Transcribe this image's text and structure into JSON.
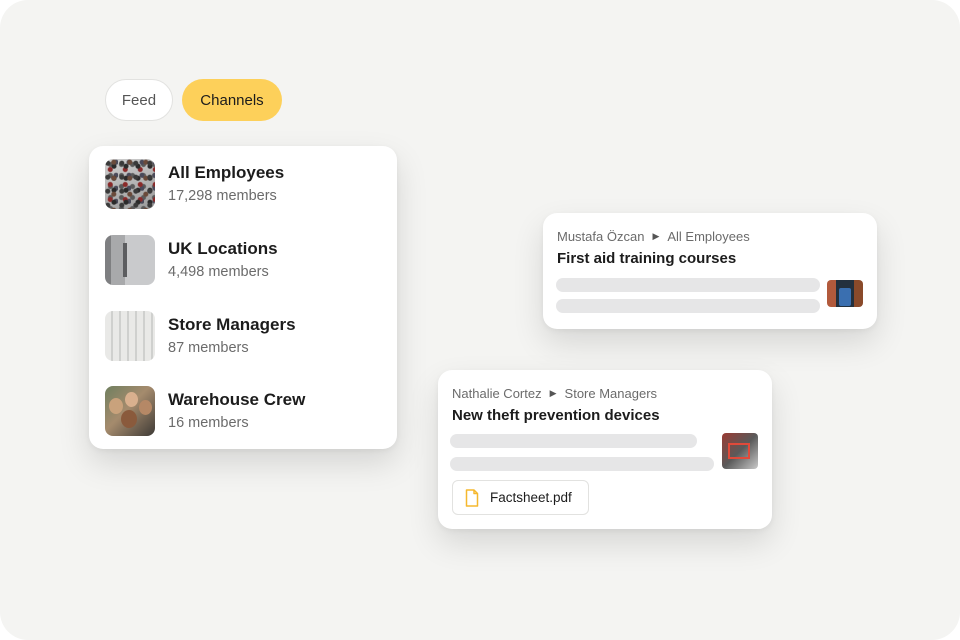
{
  "tabs": [
    {
      "label": "Feed"
    },
    {
      "label": "Channels"
    }
  ],
  "channels": [
    {
      "name": "All Employees",
      "members": "17,298 members",
      "icon": "crowd-photo"
    },
    {
      "name": "UK Locations",
      "members": "4,498 members",
      "icon": "building-photo"
    },
    {
      "name": "Store Managers",
      "members": "87 members",
      "icon": "facade-photo"
    },
    {
      "name": "Warehouse Crew",
      "members": "16 members",
      "icon": "team-photo"
    }
  ],
  "posts": [
    {
      "author": "Mustafa Özcan",
      "channel": "All Employees",
      "title": "First aid training courses"
    },
    {
      "author": "Nathalie Cortez",
      "channel": "Store Managers",
      "title": "New theft prevention devices",
      "attachment": "Factsheet.pdf"
    }
  ],
  "colors": {
    "accent": "#fdd05a",
    "background": "#f4f4f2",
    "skeleton": "#e6e6e7",
    "file_icon": "#f5b82e"
  }
}
